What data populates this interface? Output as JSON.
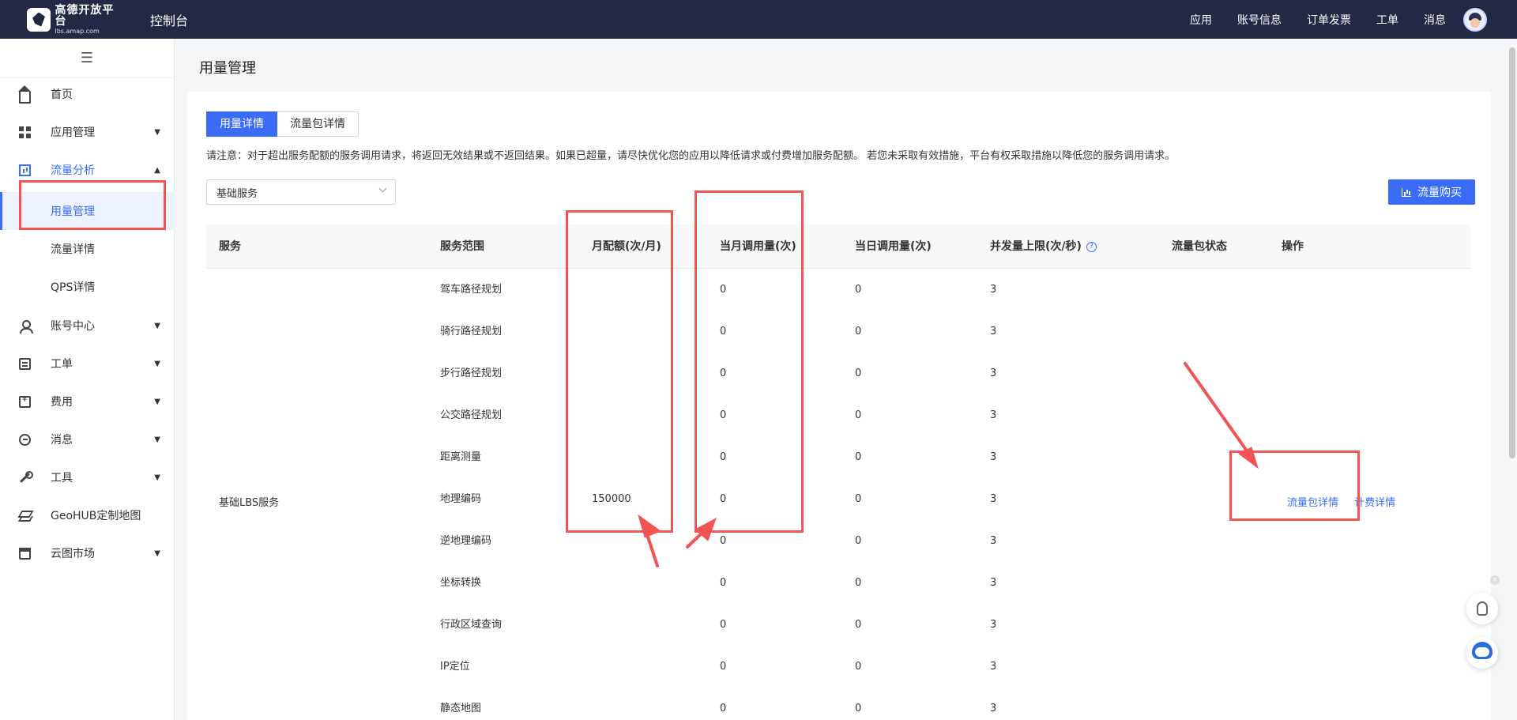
{
  "topbar": {
    "logo_main": "高德开放平台",
    "logo_sub": "lbs.amap.com",
    "console": "控制台",
    "nav": [
      "应用",
      "账号信息",
      "订单发票",
      "工单",
      "消息"
    ]
  },
  "sidebar": {
    "collapse_icon": "☰",
    "items": [
      {
        "label": "首页",
        "icon": "home-icon"
      },
      {
        "label": "应用管理",
        "icon": "grid-icon"
      },
      {
        "label": "流量分析",
        "icon": "chart-icon"
      },
      {
        "label": "账号中心",
        "icon": "user-icon"
      },
      {
        "label": "工单",
        "icon": "ticket-icon"
      },
      {
        "label": "费用",
        "icon": "money-icon"
      },
      {
        "label": "消息",
        "icon": "message-icon"
      },
      {
        "label": "工具",
        "icon": "wrench-icon"
      },
      {
        "label": "GeoHUB定制地图",
        "icon": "layers-icon"
      },
      {
        "label": "云图市场",
        "icon": "shop-icon"
      }
    ],
    "sub_items": [
      "用量管理",
      "流量详情",
      "QPS详情"
    ]
  },
  "page": {
    "title": "用量管理",
    "tabs": [
      "用量详情",
      "流量包详情"
    ],
    "notice": "请注意：对于超出服务配额的服务调用请求，将返回无效结果或不返回结果。如果已超量，请尽快优化您的应用以降低请求或付费增加服务配额。 若您未采取有效措施，平台有权采取措施以降低您的服务调用请求。",
    "select_value": "基础服务",
    "buy_button": "流量购买"
  },
  "table": {
    "headers": [
      "服务",
      "服务范围",
      "月配额(次/月)",
      "当月调用量(次)",
      "当日调用量(次)",
      "并发量上限(次/秒)",
      "流量包状态",
      "操作"
    ],
    "service_name": "基础LBS服务",
    "rows": [
      {
        "scope": "驾车路径规划",
        "quota": "",
        "month": "0",
        "day": "0",
        "qps": "3"
      },
      {
        "scope": "骑行路径规划",
        "quota": "",
        "month": "0",
        "day": "0",
        "qps": "3"
      },
      {
        "scope": "步行路径规划",
        "quota": "",
        "month": "0",
        "day": "0",
        "qps": "3"
      },
      {
        "scope": "公交路径规划",
        "quota": "",
        "month": "0",
        "day": "0",
        "qps": "3"
      },
      {
        "scope": "距离测量",
        "quota": "",
        "month": "0",
        "day": "0",
        "qps": "3"
      },
      {
        "scope": "地理编码",
        "quota": "150000",
        "month": "0",
        "day": "0",
        "qps": "3"
      },
      {
        "scope": "逆地理编码",
        "quota": "",
        "month": "0",
        "day": "0",
        "qps": "3"
      },
      {
        "scope": "坐标转换",
        "quota": "",
        "month": "0",
        "day": "0",
        "qps": "3"
      },
      {
        "scope": "行政区域查询",
        "quota": "",
        "month": "0",
        "day": "0",
        "qps": "3"
      },
      {
        "scope": "IP定位",
        "quota": "",
        "month": "0",
        "day": "0",
        "qps": "3"
      },
      {
        "scope": "静态地图",
        "quota": "",
        "month": "0",
        "day": "0",
        "qps": "3"
      }
    ],
    "operations": [
      "流量包详情",
      "计费详情"
    ]
  },
  "colors": {
    "accent": "#3b6cf7",
    "topbar": "#232845",
    "annotation": "#f25454"
  }
}
